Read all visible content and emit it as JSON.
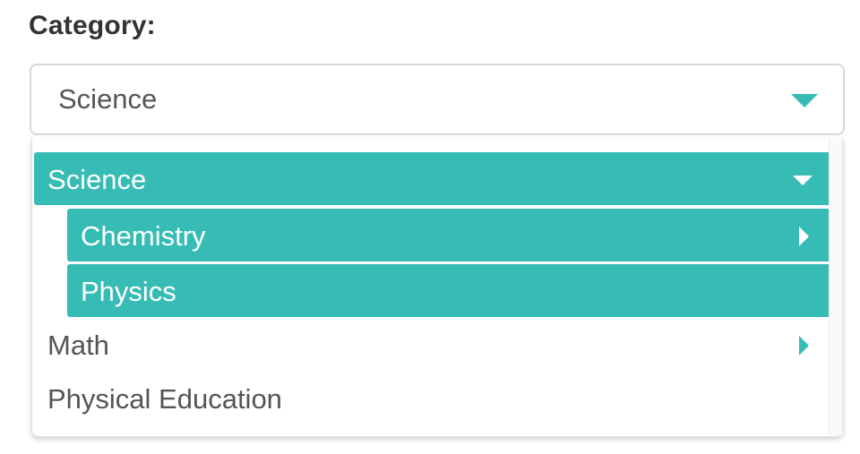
{
  "field": {
    "label": "Category:",
    "selected_value": "Science"
  },
  "dropdown": {
    "options": [
      {
        "label": "Science",
        "level": 0,
        "active": true,
        "expanded": true,
        "icon": "chevron-down-icon"
      },
      {
        "label": "Chemistry",
        "level": 1,
        "active": true,
        "expanded": false,
        "icon": "chevron-right-icon"
      },
      {
        "label": "Physics",
        "level": 1,
        "active": true
      },
      {
        "label": "Math",
        "level": 0,
        "active": false,
        "expanded": false,
        "icon": "chevron-right-icon"
      },
      {
        "label": "Physical Education",
        "level": 0,
        "active": false
      }
    ]
  },
  "colors": {
    "accent": "#36bcb5",
    "text": "#555555",
    "label": "#333333",
    "border": "#d7d7d7"
  }
}
